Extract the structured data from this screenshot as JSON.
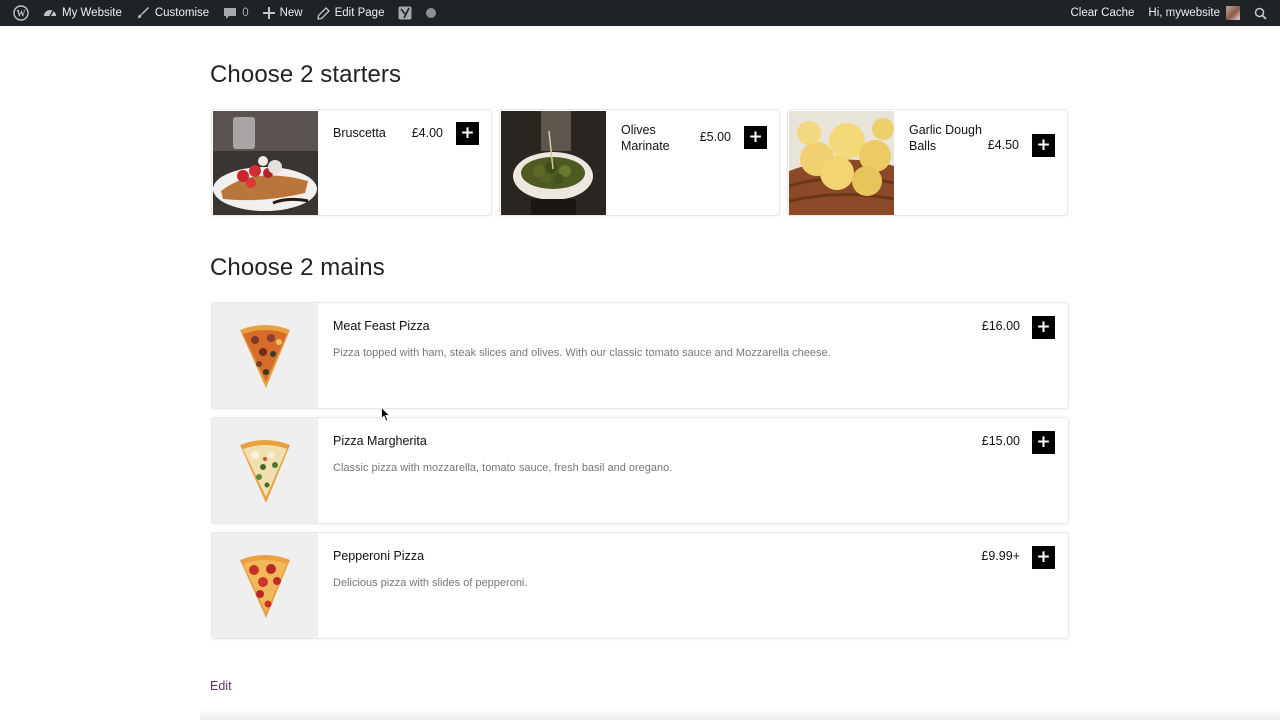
{
  "adminbar": {
    "site_name": "My Website",
    "customise": "Customise",
    "comments_count": "0",
    "new": "New",
    "edit_page": "Edit Page",
    "clear_cache": "Clear Cache",
    "greeting": "Hi, mywebsite"
  },
  "starters": {
    "title": "Choose 2 starters",
    "items": [
      {
        "name": "Bruscetta",
        "price": "£4.00"
      },
      {
        "name": "Olives Marinate",
        "price": "£5.00"
      },
      {
        "name": "Garlic Dough Balls",
        "price": "£4.50"
      }
    ]
  },
  "mains": {
    "title": "Choose 2 mains",
    "items": [
      {
        "name": "Meat Feast Pizza",
        "price": "£16.00",
        "description": "Pizza topped with ham, steak slices and olives. With our classic tomato sauce and Mozzarella cheese."
      },
      {
        "name": "Pizza Margherita",
        "price": "£15.00",
        "description": "Classic pizza with mozzarella, tomato sauce, fresh basil and oregano."
      },
      {
        "name": "Pepperoni Pizza",
        "price": "£9.99+",
        "description": "Delicious pizza with slides of pepperoni."
      }
    ]
  },
  "add_symbol": "+",
  "edit_link": "Edit",
  "icons": {
    "wordpress": "wordpress-icon",
    "site": "dashboard-icon",
    "customise": "brush-icon",
    "comments": "comment-icon",
    "new": "plus-icon",
    "edit": "pencil-icon",
    "yoast": "yoast-icon",
    "status": "status-dot-icon",
    "search": "search-icon"
  },
  "colors": {
    "adminbar_bg": "#1d2327",
    "button_bg": "#000000",
    "thumb_bg": "#efefef",
    "edit_link": "#6b2d6b"
  }
}
